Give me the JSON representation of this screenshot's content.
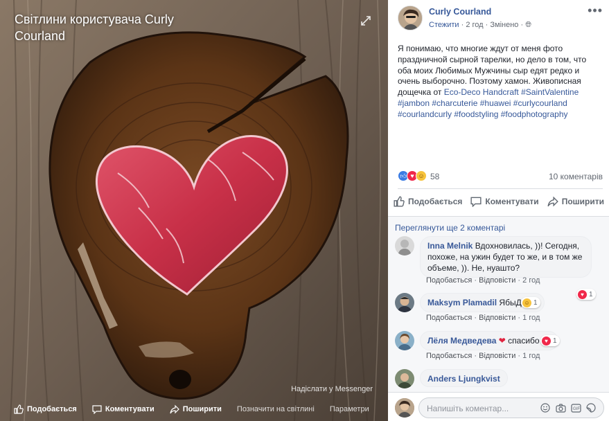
{
  "photo": {
    "title": "Світлини користувача Curly Courland",
    "messenger_link": "Надіслати у Messenger",
    "actions": [
      {
        "label": "Подобається",
        "icon": "thumbs-up-icon"
      },
      {
        "label": "Коментувати",
        "icon": "comment-icon"
      },
      {
        "label": "Поширити",
        "icon": "share-icon"
      },
      {
        "label": "Позначити на світлині",
        "icon": "tag-icon"
      },
      {
        "label": "Параметри",
        "icon": "options-icon"
      }
    ]
  },
  "post": {
    "author": "Curly Courland",
    "follow_label": "Стежити",
    "time": "2 год",
    "edited": "Змінено",
    "text_intro": "Я понимаю, что многие ждут от меня фото праздничной сырной тарелки, но дело в том, что оба моих Любимых Мужчины сыр едят редко и очень выборочно. Поэтому хамон. Живописная дощечка от ",
    "link_page": "Eco-Deco Handcraft",
    "hashtags": "#SaintValentine #jambon #charcuterie #huawei #curlycourland #courlandcurly #foodstyling #foodphotography",
    "reaction_count": "58",
    "comment_count": "10 коментарів",
    "actions": {
      "like": "Подобається",
      "comment": "Коментувати",
      "share": "Поширити"
    }
  },
  "comments": {
    "view_more": "Переглянути ще 2 коментарі",
    "like_label": "Подобається",
    "reply_label": "Відповісти",
    "items": [
      {
        "name": "Inna Melnik",
        "text": "Вдохновилась, ))! Сегодня, похоже, на ужин будет то же, и в том же объеме, )). Не, нуашто?",
        "time": "2 год",
        "reactions": "1"
      },
      {
        "name": "Maksym Plamadil",
        "text": "ЯбыДа",
        "time": "1 год",
        "reactions": "1"
      },
      {
        "name": "Лёля Медведева",
        "text": "спасибо",
        "time": "1 год",
        "reactions": "1"
      },
      {
        "name": "Anders Ljungkvist",
        "text": "",
        "time": "",
        "reactions": ""
      }
    ]
  },
  "compose": {
    "placeholder": "Напишіть коментар..."
  },
  "colors": {
    "link": "#365899",
    "meta": "#616770",
    "like_blue": "#3b7ce3",
    "love_red": "#f0284a",
    "haha_yellow": "#f7c33c"
  }
}
